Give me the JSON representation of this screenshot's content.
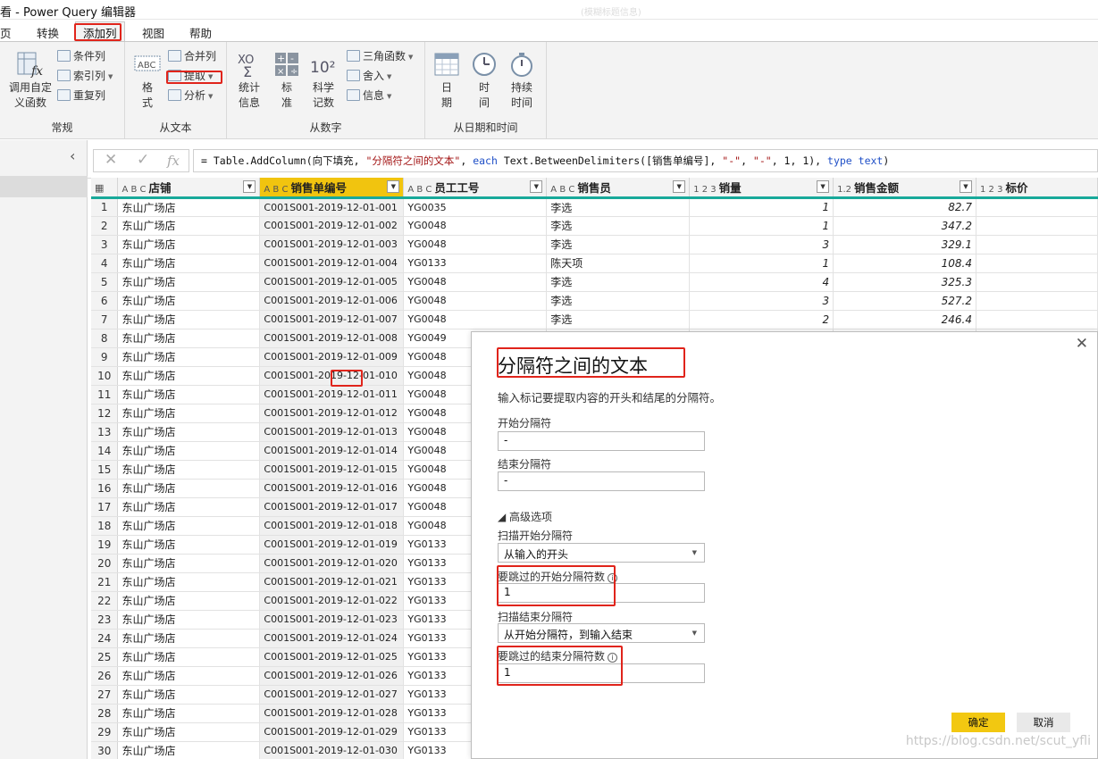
{
  "window": {
    "title": "看 - Power Query 编辑器",
    "title_right": "(模糊标题信息)"
  },
  "menu": {
    "items": [
      "页",
      "转换",
      "添加列",
      "视图",
      "帮助"
    ],
    "active": "添加列"
  },
  "ribbon": {
    "general": {
      "label": "常规",
      "invoke_custom_function": "调用自定义函数",
      "conditional_column": "条件列",
      "index_column": "索引列",
      "duplicate_column": "重复列"
    },
    "from_text": {
      "label": "从文本",
      "format": "格式",
      "merge_columns": "合并列",
      "extract": "提取",
      "parse": "分析",
      "abc_badge": "ABC",
      "abc123_badge": "123"
    },
    "from_number": {
      "label": "从数字",
      "statistics": "统计信息",
      "standard": "标准",
      "scientific": "科学记数",
      "trigonometry": "三角函数",
      "rounding": "舍入",
      "information": "信息",
      "sci_badge": "10²",
      "xo_badge": "XO"
    },
    "from_datetime": {
      "label": "从日期和时间",
      "date": "日期",
      "time": "时间",
      "duration": "持续时间"
    }
  },
  "formula": {
    "prefix": "= Table.AddColumn(向下填充, ",
    "str1": "\"分隔符之间的文本\"",
    "mid1": ", ",
    "kw1": "each",
    "mid2": " Text.BetweenDelimiters([销售单编号], ",
    "str2": "\"-\"",
    "mid3": ", ",
    "str3": "\"-\"",
    "mid4": ", 1, 1), ",
    "kw2": "type",
    "kw3": "text",
    "mid5": ")",
    "fx": "fx"
  },
  "grid": {
    "columns": [
      {
        "type": "A B C",
        "name": "店铺"
      },
      {
        "type": "A B C",
        "name": "销售单编号",
        "selected": true
      },
      {
        "type": "A B C",
        "name": "员工工号"
      },
      {
        "type": "A B C",
        "name": "销售员"
      },
      {
        "type": "1 2 3",
        "name": "销量"
      },
      {
        "type": "1.2",
        "name": "销售金额"
      },
      {
        "type": "1 2 3",
        "name": "标价"
      }
    ],
    "rows": [
      [
        "1",
        "东山广场店",
        "C001S001-2019-12-01-001",
        "YG0035",
        "李选",
        "1",
        "82.7"
      ],
      [
        "2",
        "东山广场店",
        "C001S001-2019-12-01-002",
        "YG0048",
        "李选",
        "1",
        "347.2"
      ],
      [
        "3",
        "东山广场店",
        "C001S001-2019-12-01-003",
        "YG0048",
        "李选",
        "3",
        "329.1"
      ],
      [
        "4",
        "东山广场店",
        "C001S001-2019-12-01-004",
        "YG0133",
        "陈天项",
        "1",
        "108.4"
      ],
      [
        "5",
        "东山广场店",
        "C001S001-2019-12-01-005",
        "YG0048",
        "李选",
        "4",
        "325.3"
      ],
      [
        "6",
        "东山广场店",
        "C001S001-2019-12-01-006",
        "YG0048",
        "李选",
        "3",
        "527.2"
      ],
      [
        "7",
        "东山广场店",
        "C001S001-2019-12-01-007",
        "YG0048",
        "李选",
        "2",
        "246.4"
      ],
      [
        "8",
        "东山广场店",
        "C001S001-2019-12-01-008",
        "YG0049",
        "",
        "",
        " "
      ],
      [
        "9",
        "东山广场店",
        "C001S001-2019-12-01-009",
        "YG0048",
        "",
        "",
        " "
      ],
      [
        "10",
        "东山广场店",
        "C001S001-2019-12-01-010",
        "YG0048",
        "",
        "",
        " "
      ],
      [
        "11",
        "东山广场店",
        "C001S001-2019-12-01-011",
        "YG0048",
        "",
        "",
        " "
      ],
      [
        "12",
        "东山广场店",
        "C001S001-2019-12-01-012",
        "YG0048",
        "",
        "",
        " "
      ],
      [
        "13",
        "东山广场店",
        "C001S001-2019-12-01-013",
        "YG0048",
        "",
        "",
        " "
      ],
      [
        "14",
        "东山广场店",
        "C001S001-2019-12-01-014",
        "YG0048",
        "",
        "",
        " "
      ],
      [
        "15",
        "东山广场店",
        "C001S001-2019-12-01-015",
        "YG0048",
        "",
        "",
        " "
      ],
      [
        "16",
        "东山广场店",
        "C001S001-2019-12-01-016",
        "YG0048",
        "",
        "",
        " "
      ],
      [
        "17",
        "东山广场店",
        "C001S001-2019-12-01-017",
        "YG0048",
        "",
        "",
        " "
      ],
      [
        "18",
        "东山广场店",
        "C001S001-2019-12-01-018",
        "YG0048",
        "",
        "",
        " "
      ],
      [
        "19",
        "东山广场店",
        "C001S001-2019-12-01-019",
        "YG0133",
        "",
        "",
        " "
      ],
      [
        "20",
        "东山广场店",
        "C001S001-2019-12-01-020",
        "YG0133",
        "",
        "",
        " "
      ],
      [
        "21",
        "东山广场店",
        "C001S001-2019-12-01-021",
        "YG0133",
        "",
        "",
        " "
      ],
      [
        "22",
        "东山广场店",
        "C001S001-2019-12-01-022",
        "YG0133",
        "",
        "",
        " "
      ],
      [
        "23",
        "东山广场店",
        "C001S001-2019-12-01-023",
        "YG0133",
        "",
        "",
        " "
      ],
      [
        "24",
        "东山广场店",
        "C001S001-2019-12-01-024",
        "YG0133",
        "",
        "",
        " "
      ],
      [
        "25",
        "东山广场店",
        "C001S001-2019-12-01-025",
        "YG0133",
        "",
        "",
        " "
      ],
      [
        "26",
        "东山广场店",
        "C001S001-2019-12-01-026",
        "YG0133",
        "",
        "",
        " "
      ],
      [
        "27",
        "东山广场店",
        "C001S001-2019-12-01-027",
        "YG0133",
        "",
        "",
        " "
      ],
      [
        "28",
        "东山广场店",
        "C001S001-2019-12-01-028",
        "YG0133",
        "",
        "",
        " "
      ],
      [
        "29",
        "东山广场店",
        "C001S001-2019-12-01-029",
        "YG0133",
        "",
        "",
        " "
      ],
      [
        "30",
        "东山广场店",
        "C001S001-2019-12-01-030",
        "YG0133",
        "",
        "",
        " "
      ]
    ]
  },
  "dialog": {
    "title": "分隔符之间的文本",
    "description": "输入标记要提取内容的开头和结尾的分隔符。",
    "start_delimiter_label": "开始分隔符",
    "start_delimiter_value": "-",
    "end_delimiter_label": "结束分隔符",
    "end_delimiter_value": "-",
    "advanced_label": "◢ 高级选项",
    "scan_start_label": "扫描开始分隔符",
    "scan_start_value": "从输入的开头",
    "skip_start_label": "要跳过的开始分隔符数",
    "skip_start_value": "1",
    "scan_end_label": "扫描结束分隔符",
    "scan_end_value": "从开始分隔符，到输入结束",
    "skip_end_label": "要跳过的结束分隔符数",
    "skip_end_value": "1",
    "ok": "确定",
    "cancel": "取消"
  },
  "watermark": "https://blog.csdn.net/scut_yfli",
  "colors": {
    "accent_yellow": "#f2c811",
    "teal": "#18a99a",
    "highlight_red": "#e0241b"
  }
}
